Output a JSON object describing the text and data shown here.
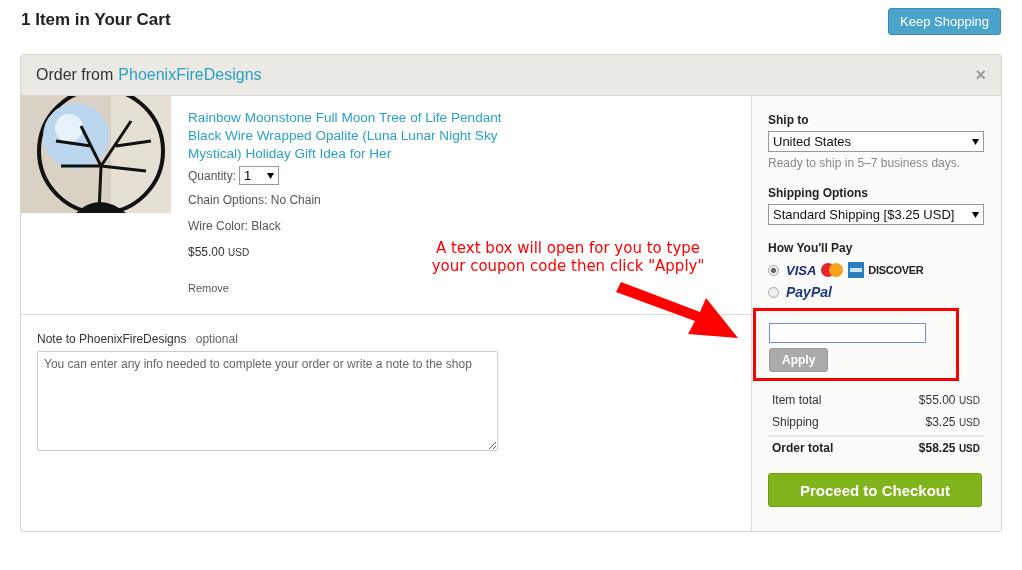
{
  "header": {
    "title": "1 Item in Your Cart",
    "keep_shopping": "Keep Shopping"
  },
  "order": {
    "prefix": "Order from",
    "shop": "PhoenixFireDesigns",
    "close": "×"
  },
  "item": {
    "image": {
      "kind": "picture"
    },
    "title": "Rainbow Moonstone Full Moon Tree of Life Pendant Black Wire Wrapped Opalite (Luna Lunar Night Sky Mystical) Holiday Gift Idea for Her",
    "quantity_label": "Quantity:",
    "quantity": "1",
    "options": [
      "Chain Options: No Chain",
      "Wire Color: Black"
    ],
    "price": "$55.00",
    "currency": "USD",
    "remove": "Remove"
  },
  "note": {
    "label": "Note to PhoenixFireDesigns",
    "optional": "optional",
    "placeholder": "You can enter any info needed to complete your order or write a note to the shop"
  },
  "ship_to": {
    "label": "Ship to",
    "value": "United States",
    "hint": "Ready to ship in 5–7 business days."
  },
  "shipping_options": {
    "label": "Shipping Options",
    "value": "Standard Shipping [$3.25 USD]"
  },
  "payment": {
    "label": "How You'll Pay",
    "methods": [
      {
        "kind": "cards",
        "selected": true,
        "logos": [
          {
            "kind": "visa",
            "label": "VISA"
          },
          {
            "kind": "mastercard"
          },
          {
            "kind": "amex"
          },
          {
            "kind": "discover",
            "label": "DISCOVER"
          }
        ]
      },
      {
        "kind": "paypal",
        "selected": false,
        "label": "PayPal"
      }
    ]
  },
  "coupon": {
    "button": "Apply",
    "disabled": true
  },
  "totals": [
    {
      "kind": "line",
      "label": "Item total",
      "amount": "$55.00",
      "currency": "USD"
    },
    {
      "kind": "line",
      "label": "Shipping",
      "amount": "$3.25",
      "currency": "USD"
    },
    {
      "kind": "total",
      "label": "Order total",
      "amount": "$58.25",
      "currency": "USD"
    }
  ],
  "checkout": "Proceed to Checkout",
  "annotation": {
    "lines": [
      "A text box will open for you to type",
      "your coupon code then click \"Apply\""
    ]
  }
}
